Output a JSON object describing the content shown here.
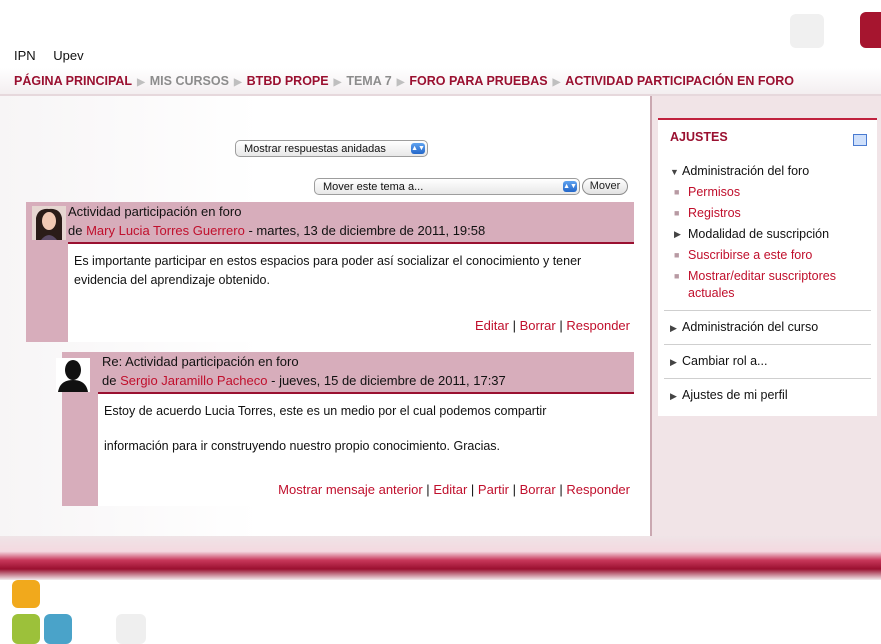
{
  "topnav": {
    "item1": "IPN",
    "item2": "Upev"
  },
  "breadcrumb": {
    "items": [
      "PÁGINA PRINCIPAL",
      "MIS CURSOS",
      "BTBD PROPE",
      "TEMA 7",
      "FORO PARA PRUEBAS",
      "ACTIVIDAD PARTICIPACIÓN EN FORO"
    ],
    "separator": "▶"
  },
  "controls": {
    "display_mode": "Mostrar respuestas anidadas",
    "move_select": "Mover este tema a...",
    "move_button": "Mover",
    "select_arrow": "▲▼"
  },
  "posts": [
    {
      "subject": "Actividad participación en foro",
      "by_prefix": "de",
      "author": "Mary Lucia Torres Guerrero",
      "date": "- martes, 13 de diciembre de 2011, 19:58",
      "body": "Es importante participar en estos espacios para poder así socializar el conocimiento y tener evidencia del aprendizaje obtenido.",
      "cmd_edit": "Editar",
      "cmd_delete": "Borrar",
      "cmd_reply": "Responder",
      "sep": "|"
    },
    {
      "subject": "Re: Actividad participación en foro",
      "by_prefix": "de",
      "author": "Sergio Jaramillo Pacheco",
      "date": "- jueves, 15 de diciembre de 2011, 17:37",
      "body_line1": "Estoy de acuerdo Lucia Torres, este es un medio por el cual podemos compartir",
      "body_line2": "información para ir construyendo nuestro propio conocimiento. Gracias.",
      "cmd_parent": "Mostrar mensaje anterior",
      "cmd_edit": "Editar",
      "cmd_split": "Partir",
      "cmd_delete": "Borrar",
      "cmd_reply": "Responder",
      "sep": "|"
    }
  ],
  "settings": {
    "title": "AJUSTES",
    "forum_admin": "Administración del foro",
    "permissions": "Permisos",
    "logs": "Registros",
    "subscription_mode": "Modalidad de suscripción",
    "subscribe": "Suscribirse a este foro",
    "show_subscribers": "Mostrar/editar suscriptores actuales",
    "course_admin": "Administración del curso",
    "switch_role": "Cambiar rol a...",
    "profile_settings": "Ajustes de mi perfil"
  },
  "colors": {
    "accent": "#9a1030",
    "link": "#c00f2c",
    "post_bg": "#d7adbb",
    "sidebar_bg": "#f1e4e7"
  }
}
